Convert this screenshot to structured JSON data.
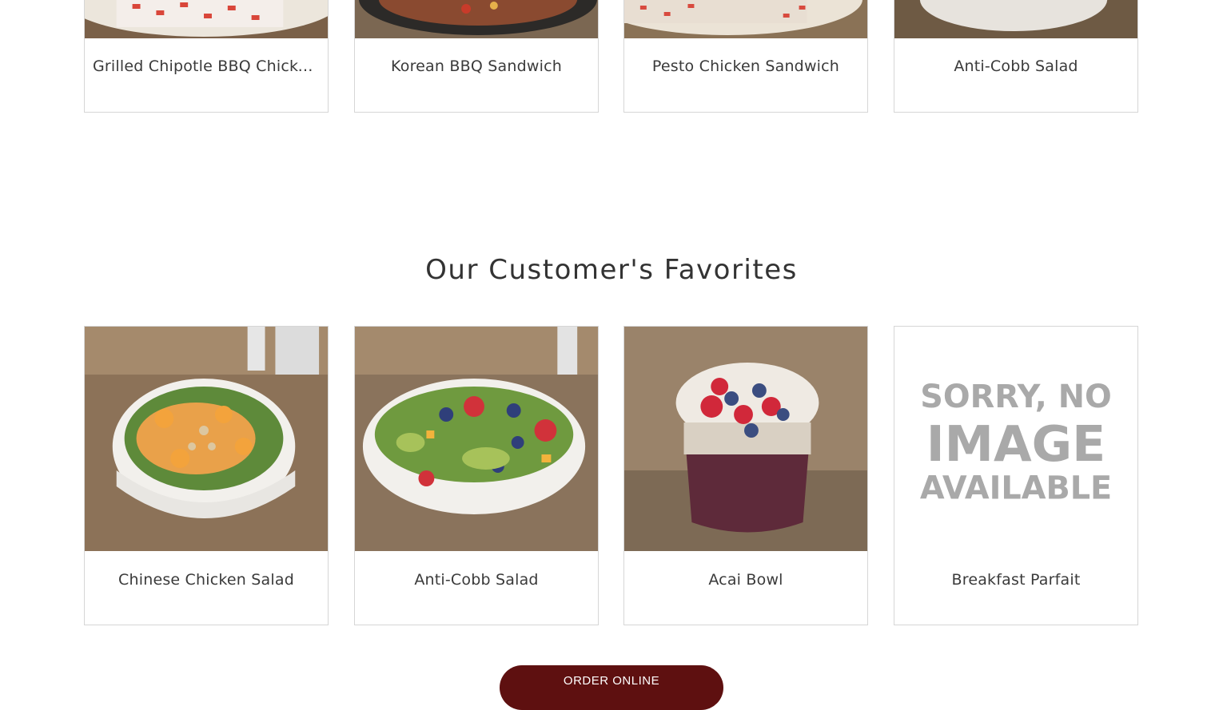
{
  "top_row": {
    "items": [
      {
        "name": "Grilled Chipotle BBQ Chicken Sandwich"
      },
      {
        "name": "Korean BBQ Sandwich"
      },
      {
        "name": "Pesto Chicken Sandwich"
      },
      {
        "name": "Anti-Cobb Salad"
      }
    ]
  },
  "favorites": {
    "title": "Our Customer's Favorites",
    "items": [
      {
        "name": "Chinese Chicken Salad"
      },
      {
        "name": "Anti-Cobb Salad"
      },
      {
        "name": "Acai Bowl"
      },
      {
        "name": "Breakfast Parfait"
      }
    ],
    "no_image_text": [
      "SORRY, NO",
      "IMAGE",
      "AVAILABLE"
    ]
  },
  "order_button": {
    "label": "ORDER ONLINE"
  }
}
